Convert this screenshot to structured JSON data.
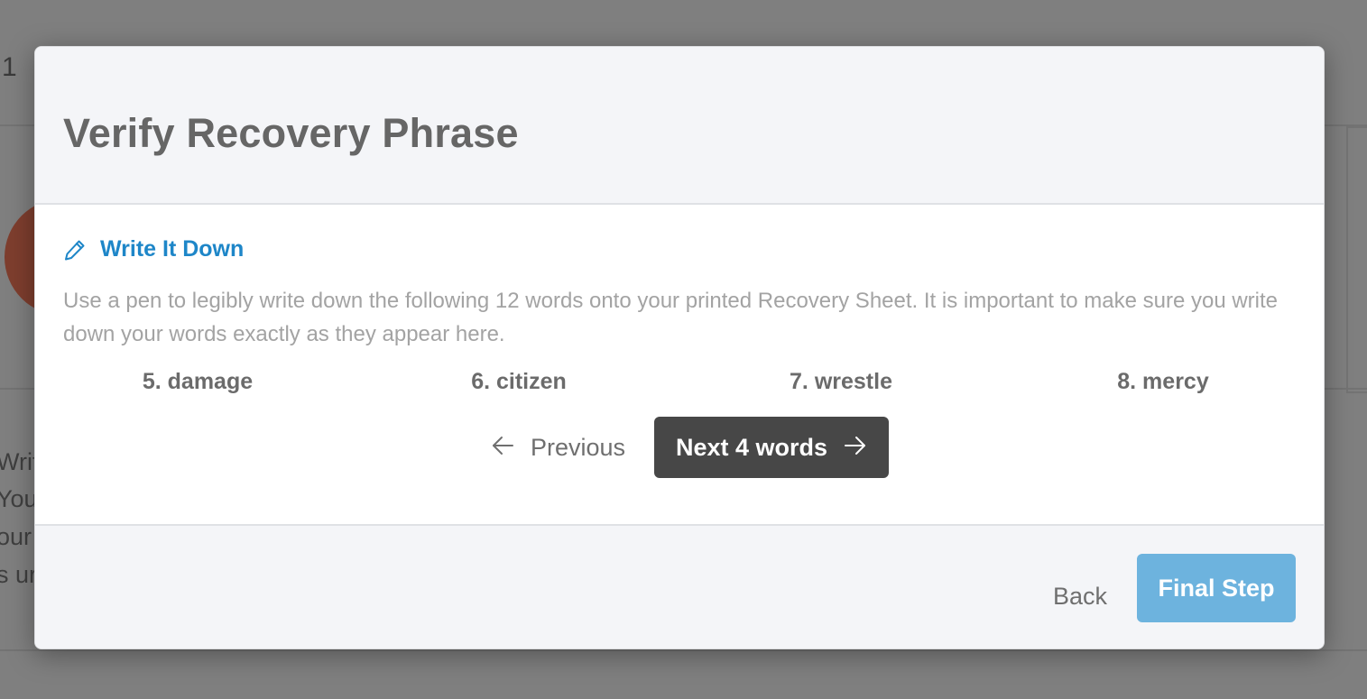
{
  "background": {
    "step_number": "1",
    "text_fragments": [
      "Writ",
      "Your",
      "our",
      "s ur"
    ]
  },
  "modal": {
    "title": "Verify Recovery Phrase",
    "section": {
      "icon": "pencil-icon",
      "title": "Write It Down",
      "instructions": "Use a pen to legibly write down the following 12 words onto your printed Recovery Sheet. It is important to make sure you write down your words exactly as they appear here."
    },
    "words": [
      "5. damage",
      "6. citizen",
      "7. wrestle",
      "8. mercy"
    ],
    "pager": {
      "previous_label": "Previous",
      "next_label": "Next 4 words"
    },
    "footer": {
      "back_label": "Back",
      "final_label": "Final Step"
    }
  },
  "colors": {
    "accent": "#1e86c8",
    "final_button": "#6db3de",
    "next_button": "#474747",
    "overlay": "#7f7f7f"
  }
}
